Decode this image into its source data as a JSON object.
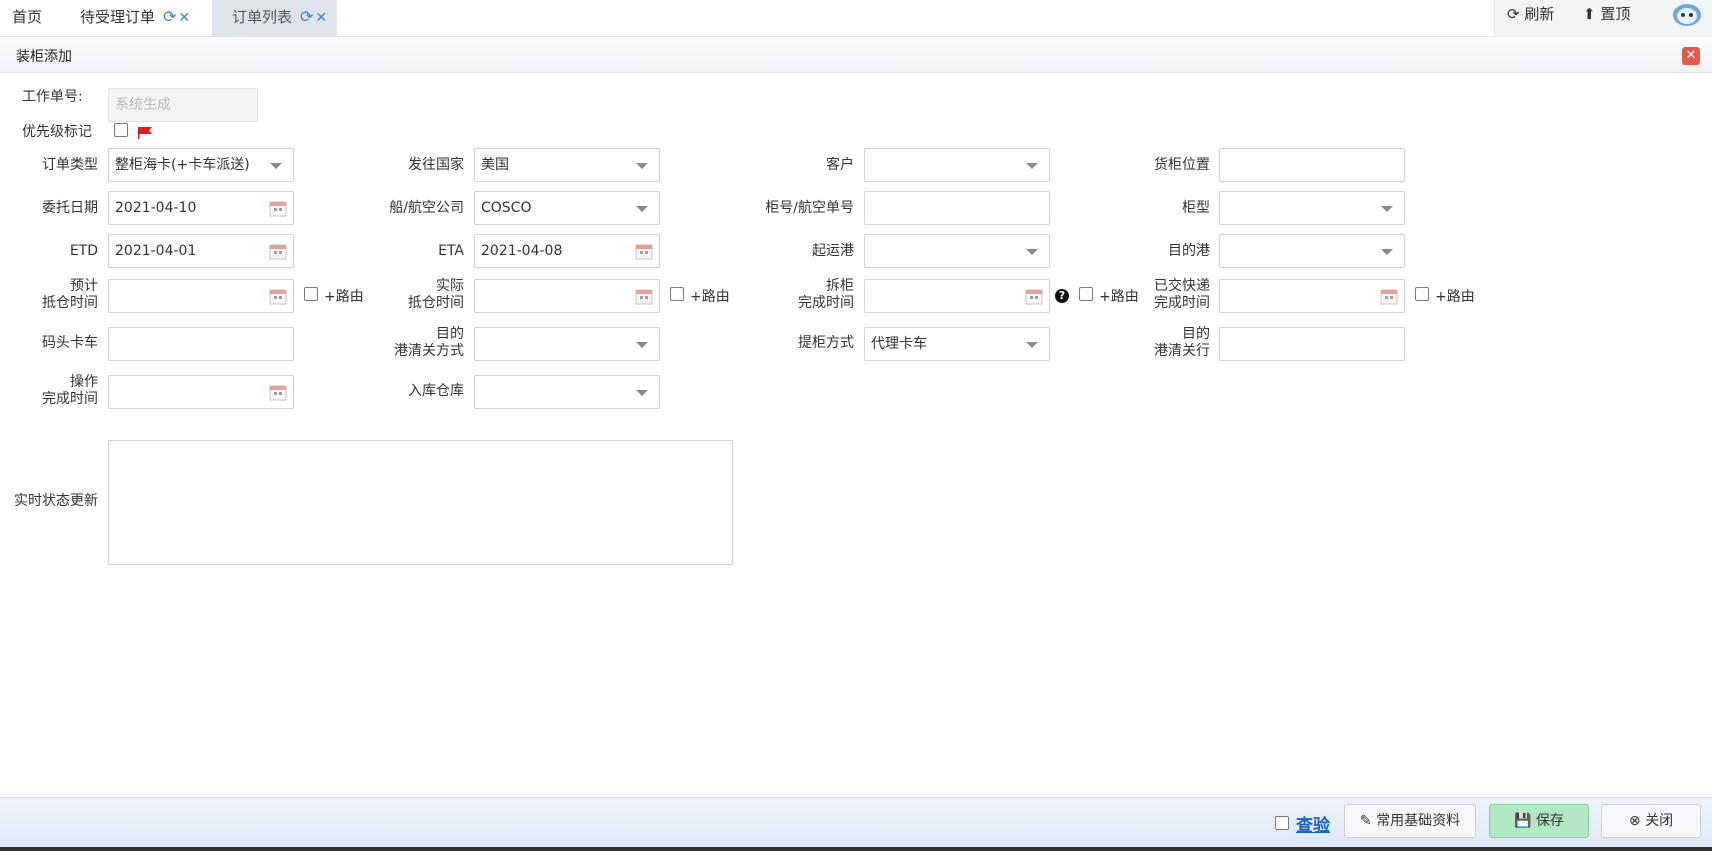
{
  "tabs": {
    "home": "首页",
    "pending": "待受理订单",
    "list": "订单列表"
  },
  "tools": {
    "refresh": "刷新",
    "top": "置顶"
  },
  "panel": {
    "title": "装柜添加"
  },
  "form": {
    "work_no_label": "工作单号:",
    "work_no_placeholder": "系统生成",
    "priority_label": "优先级标记",
    "row1": {
      "order_type_label": "订单类型",
      "order_type_value": "整柜海卡(+卡车派送)",
      "country_label": "发往国家",
      "country_value": "美国",
      "customer_label": "客户",
      "customer_value": "",
      "container_loc_label": "货柜位置",
      "container_loc_value": ""
    },
    "row2": {
      "entrust_date_label": "委托日期",
      "entrust_date_value": "2021-04-10",
      "carrier_label": "船/航空公司",
      "carrier_value": "COSCO",
      "container_no_label": "柜号/航空单号",
      "container_no_value": "",
      "container_type_label": "柜型",
      "container_type_value": ""
    },
    "row3": {
      "etd_label": "ETD",
      "etd_value": "2021-04-01",
      "eta_label": "ETA",
      "eta_value": "2021-04-08",
      "pol_label": "起运港",
      "pol_value": "",
      "pod_label": "目的港",
      "pod_value": ""
    },
    "row4": {
      "est_arrival_label_1": "预计",
      "est_arrival_label_2": "抵仓时间",
      "act_arrival_label_1": "实际",
      "act_arrival_label_2": "抵仓时间",
      "unload_label_1": "拆柜",
      "unload_label_2": "完成时间",
      "express_label_1": "已交快递",
      "express_label_2": "完成时间",
      "route_label": "+路由"
    },
    "row5": {
      "dock_truck_label": "码头卡车",
      "dock_truck_value": "",
      "customs_mode_label_1": "目的",
      "customs_mode_label_2": "港清关方式",
      "customs_mode_value": "",
      "pickup_label": "提柜方式",
      "pickup_value": "代理卡车",
      "customs_agent_label_1": "目的",
      "customs_agent_label_2": "港清关行",
      "customs_agent_value": ""
    },
    "row6": {
      "op_done_label_1": "操作",
      "op_done_label_2": "完成时间",
      "warehouse_label": "入库仓库",
      "warehouse_value": ""
    },
    "status_label": "实时状态更新"
  },
  "footer": {
    "inspect": "查验",
    "basic": "常用基础资料",
    "save": "保存",
    "close": "关闭"
  },
  "colors": {
    "accent": "#3b82d6",
    "close_red": "#e05b4a",
    "save_green": "#b3e8c4"
  }
}
